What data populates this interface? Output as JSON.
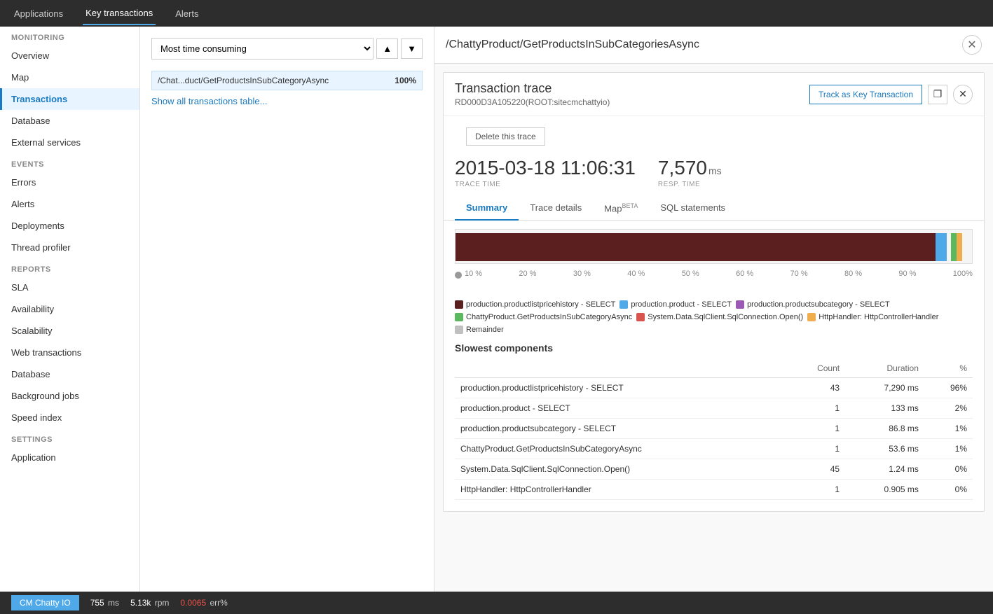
{
  "topNav": {
    "items": [
      {
        "label": "Applications",
        "active": false
      },
      {
        "label": "Key transactions",
        "active": true
      },
      {
        "label": "Alerts",
        "active": false
      }
    ]
  },
  "sidebar": {
    "monitoring_label": "MONITORING",
    "events_label": "EVENTS",
    "reports_label": "REPORTS",
    "settings_label": "SETTINGS",
    "monitoring_items": [
      {
        "label": "Overview",
        "active": false
      },
      {
        "label": "Map",
        "active": false
      },
      {
        "label": "Transactions",
        "active": true
      },
      {
        "label": "Database",
        "active": false
      },
      {
        "label": "External services",
        "active": false
      }
    ],
    "events_items": [
      {
        "label": "Errors",
        "active": false
      },
      {
        "label": "Alerts",
        "active": false
      },
      {
        "label": "Deployments",
        "active": false
      },
      {
        "label": "Thread profiler",
        "active": false
      }
    ],
    "reports_items": [
      {
        "label": "SLA",
        "active": false
      },
      {
        "label": "Availability",
        "active": false
      },
      {
        "label": "Scalability",
        "active": false
      },
      {
        "label": "Web transactions",
        "active": false
      },
      {
        "label": "Database",
        "active": false
      },
      {
        "label": "Background jobs",
        "active": false
      },
      {
        "label": "Speed index",
        "active": false
      }
    ],
    "settings_items": [
      {
        "label": "Application",
        "active": false
      }
    ]
  },
  "middlePanel": {
    "filterLabel": "Most time consuming",
    "transaction": {
      "label": "/Chat...duct/GetProductsInSubCategoryAsync",
      "pct": "100%"
    },
    "showAllLink": "Show all transactions table..."
  },
  "rightPanel": {
    "headerTitle": "/ChattyProduct/GetProductsInSubCategoriesAsync",
    "trace": {
      "title": "Transaction trace",
      "subtitle": "RD000D3A105220(ROOT:sitecmchattyio)",
      "trackLabel": "Track as Key Transaction",
      "deleteLabel": "Delete this trace",
      "traceTime": "2015-03-18 11:06:31",
      "traceTimeLabel": "TRACE TIME",
      "respTime": "7,570",
      "respTimeUnit": "ms",
      "respTimeLabel": "RESP. TIME"
    },
    "tabs": [
      {
        "label": "Summary",
        "active": true
      },
      {
        "label": "Trace details",
        "active": false
      },
      {
        "label": "Map",
        "active": false,
        "beta": "BETA"
      },
      {
        "label": "SQL statements",
        "active": false
      }
    ],
    "chart": {
      "ticks": [
        "10 %",
        "20 %",
        "30 %",
        "40 %",
        "50 %",
        "60 %",
        "70 %",
        "80 %",
        "90 %",
        "100%"
      ]
    },
    "legend": [
      {
        "label": "production.productlistpricehistory - SELECT",
        "color": "#5c1f1f"
      },
      {
        "label": "production.product - SELECT",
        "color": "#4fa8e8"
      },
      {
        "label": "production.productsubcategory - SELECT",
        "color": "#9b59b6"
      },
      {
        "label": "ChattyProduct.GetProductsInSubCategoryAsync",
        "color": "#5cb85c"
      },
      {
        "label": "System.Data.SqlClient.SqlConnection.Open()",
        "color": "#d9534f"
      },
      {
        "label": "HttpHandler: HttpControllerHandler",
        "color": "#f0ad4e"
      },
      {
        "label": "Remainder",
        "color": "#c0c0c0"
      }
    ],
    "slowestTitle": "Slowest components",
    "tableHeaders": [
      "",
      "Count",
      "Duration",
      "%"
    ],
    "tableRows": [
      {
        "name": "production.productlistpricehistory - SELECT",
        "count": "43",
        "duration": "7,290 ms",
        "pct": "96%"
      },
      {
        "name": "production.product - SELECT",
        "count": "1",
        "duration": "133 ms",
        "pct": "2%"
      },
      {
        "name": "production.productsubcategory - SELECT",
        "count": "1",
        "duration": "86.8 ms",
        "pct": "1%"
      },
      {
        "name": "ChattyProduct.GetProductsInSubCategoryAsync",
        "count": "1",
        "duration": "53.6 ms",
        "pct": "1%"
      },
      {
        "name": "System.Data.SqlClient.SqlConnection.Open()",
        "count": "45",
        "duration": "1.24 ms",
        "pct": "0%"
      },
      {
        "name": "HttpHandler: HttpControllerHandler",
        "count": "1",
        "duration": "0.905 ms",
        "pct": "0%"
      }
    ]
  },
  "bottomBar": {
    "appName": "CM Chatty IO",
    "stats": [
      {
        "value": "755",
        "unit": "ms",
        "label": ""
      },
      {
        "value": "5.13k",
        "unit": "rpm",
        "label": ""
      },
      {
        "value": "0.0065",
        "unit": "err%",
        "error": true
      }
    ]
  }
}
